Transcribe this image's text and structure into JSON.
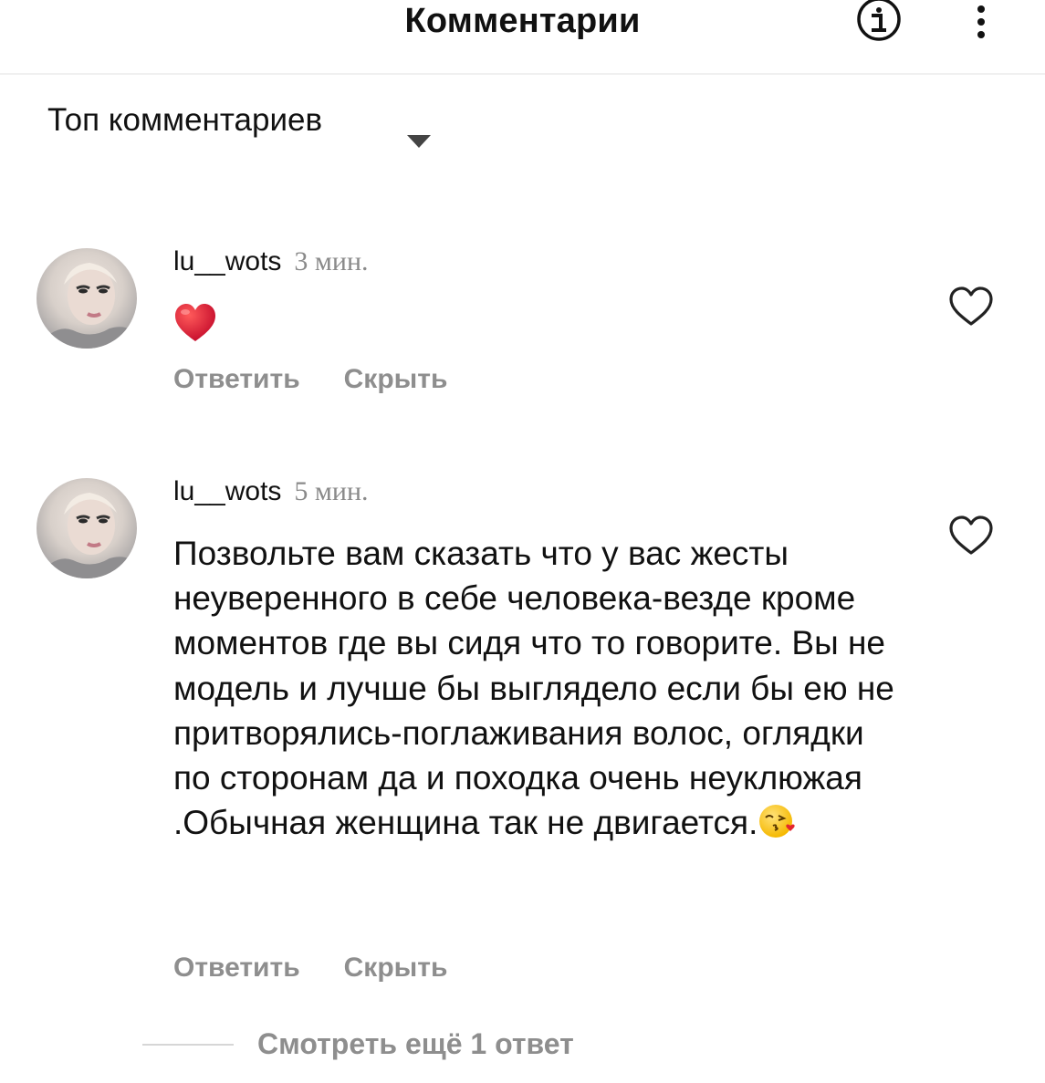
{
  "header": {
    "title": "Комментарии",
    "info_icon": "info-circle-icon",
    "more_icon": "more-vertical-icon"
  },
  "sort": {
    "label": "Топ комментариев",
    "icon": "dropdown-arrow-icon"
  },
  "comments": [
    {
      "username": "lu__wots",
      "time": "3 мин.",
      "content_emoji": "red-heart-emoji",
      "reply_label": "Ответить",
      "hide_label": "Скрыть",
      "like_icon": "heart-outline-icon"
    },
    {
      "username": "lu__wots",
      "time": "5 мин.",
      "text": "Позвольте вам сказать что у вас жесты неуверенного в себе человека-везде кроме моментов где вы сидя что то говорите. Вы не модель и лучше бы выглядело если бы ею не притворялись-поглаживания волос, оглядки по сторонам да и походка очень неуклюжая .Обычная женщина так не двигается.",
      "trailing_emoji": "face-blowing-kiss-emoji",
      "reply_label": "Ответить",
      "hide_label": "Скрыть",
      "like_icon": "heart-outline-icon"
    }
  ],
  "view_replies": {
    "label": "Смотреть ещё 1 ответ"
  },
  "colors": {
    "text": "#111111",
    "muted": "#8e8e8e",
    "heart": "#e0245e",
    "divider": "#f0f0f0"
  }
}
